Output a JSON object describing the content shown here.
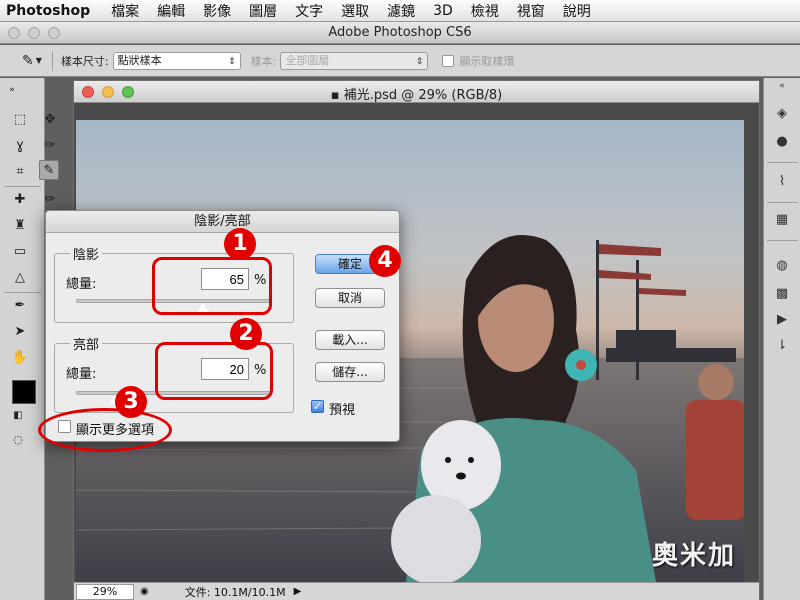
{
  "menubar": {
    "app_name": "Photoshop",
    "items": [
      "檔案",
      "編輯",
      "影像",
      "圖層",
      "文字",
      "選取",
      "濾鏡",
      "3D",
      "檢視",
      "視窗",
      "說明"
    ]
  },
  "titlebar": {
    "title": "Adobe Photoshop CS6"
  },
  "options_bar": {
    "tool_icon": "eyedropper-icon",
    "sample_size_label": "樣本尺寸:",
    "sample_size_value": "點狀樣本",
    "sample_label": "樣本:",
    "sample_value": "全部圖層",
    "show_ring_label": "顯示取樣環"
  },
  "document": {
    "title": "補光.psd @ 29% (RGB/8)",
    "zoom": "29%",
    "file_info": "文件: 10.1M/10.1M",
    "watermark": "奧米加"
  },
  "dialog": {
    "title": "陰影/亮部",
    "shadows": {
      "legend": "陰影",
      "amount_label": "總量:",
      "amount_value": "65",
      "unit": "%",
      "amount_fraction": 0.65
    },
    "highlights": {
      "legend": "亮部",
      "amount_label": "總量:",
      "amount_value": "20",
      "unit": "%",
      "amount_fraction": 0.2
    },
    "show_more_label": "顯示更多選項",
    "buttons": {
      "ok": "確定",
      "cancel": "取消",
      "load": "載入...",
      "save": "儲存..."
    },
    "preview_label": "預視",
    "preview_checked": true
  },
  "annotations": [
    "1",
    "2",
    "3",
    "4"
  ],
  "colors": {
    "annotation_red": "#e10000",
    "default_button": "#6aa4ea"
  }
}
